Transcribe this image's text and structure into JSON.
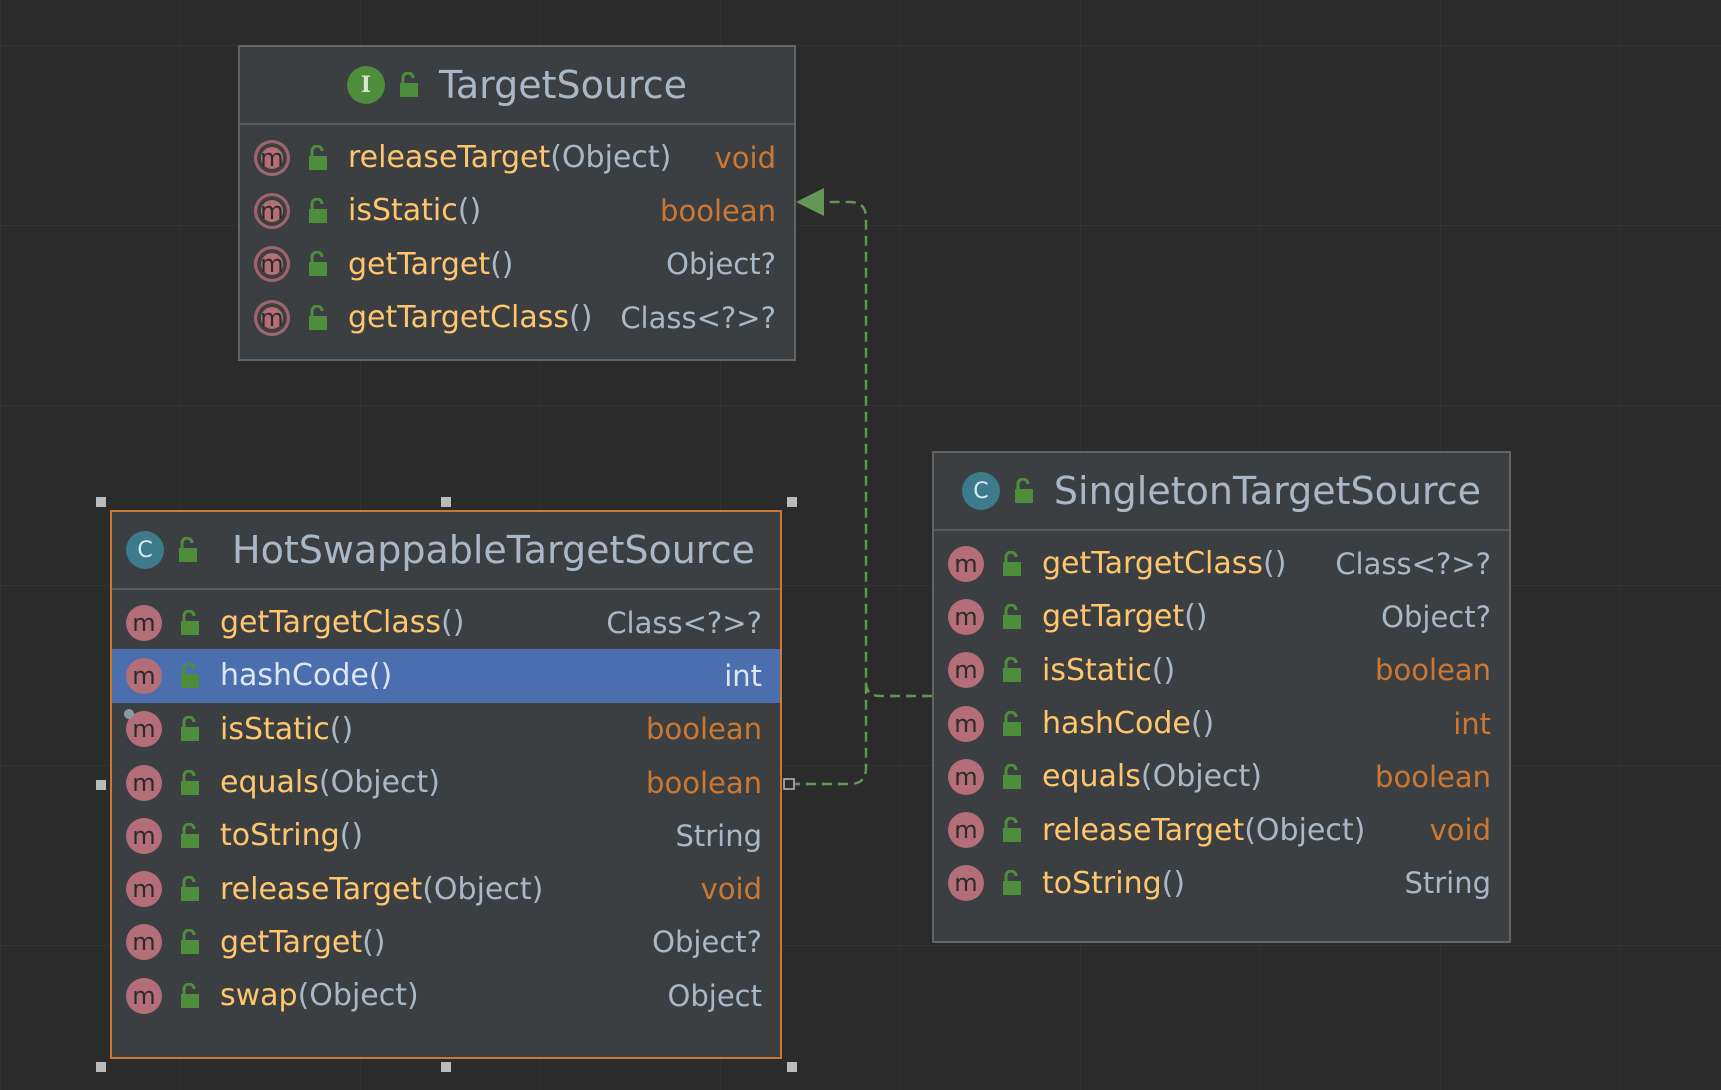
{
  "diagram": {
    "nodes": [
      {
        "id": "target-source",
        "title": "TargetSource",
        "kind": "interface",
        "kind_letter": "I",
        "methods": [
          {
            "name": "releaseTarget",
            "params": "(Object)",
            "type": "void",
            "type_is_keyword": true
          },
          {
            "name": "isStatic",
            "params": "()",
            "type": "boolean",
            "type_is_keyword": true
          },
          {
            "name": "getTarget",
            "params": "()",
            "type": "Object?",
            "type_is_keyword": false
          },
          {
            "name": "getTargetClass",
            "params": "()",
            "type": "Class<?>?",
            "type_is_keyword": false
          }
        ]
      },
      {
        "id": "singleton-target-source",
        "title": "SingletonTargetSource",
        "kind": "class",
        "kind_letter": "C",
        "methods": [
          {
            "name": "getTargetClass",
            "params": "()",
            "type": "Class<?>?",
            "type_is_keyword": false
          },
          {
            "name": "getTarget",
            "params": "()",
            "type": "Object?",
            "type_is_keyword": false
          },
          {
            "name": "isStatic",
            "params": "()",
            "type": "boolean",
            "type_is_keyword": true
          },
          {
            "name": "hashCode",
            "params": "()",
            "type": "int",
            "type_is_keyword": true
          },
          {
            "name": "equals",
            "params": "(Object)",
            "type": "boolean",
            "type_is_keyword": true
          },
          {
            "name": "releaseTarget",
            "params": "(Object)",
            "type": "void",
            "type_is_keyword": true
          },
          {
            "name": "toString",
            "params": "()",
            "type": "String",
            "type_is_keyword": false
          }
        ]
      },
      {
        "id": "hot-swappable-target-source",
        "title": "HotSwappableTargetSource",
        "kind": "class",
        "kind_letter": "C",
        "selected": true,
        "methods": [
          {
            "name": "getTargetClass",
            "params": "()",
            "type": "Class<?>?",
            "type_is_keyword": false
          },
          {
            "name": "hashCode",
            "params": "()",
            "type": "int",
            "type_is_keyword": true,
            "selected": true
          },
          {
            "name": "isStatic",
            "params": "()",
            "type": "boolean",
            "type_is_keyword": true
          },
          {
            "name": "equals",
            "params": "(Object)",
            "type": "boolean",
            "type_is_keyword": true
          },
          {
            "name": "toString",
            "params": "()",
            "type": "String",
            "type_is_keyword": false
          },
          {
            "name": "releaseTarget",
            "params": "(Object)",
            "type": "void",
            "type_is_keyword": true
          },
          {
            "name": "getTarget",
            "params": "()",
            "type": "Object?",
            "type_is_keyword": false
          },
          {
            "name": "swap",
            "params": "(Object)",
            "type": "Object",
            "type_is_keyword": false
          }
        ]
      }
    ],
    "method_icon_letter": "m",
    "relations": [
      {
        "from": "hot-swappable-target-source",
        "to": "target-source",
        "kind": "implements"
      },
      {
        "from": "singleton-target-source",
        "to": "target-source",
        "kind": "implements"
      }
    ],
    "colors": {
      "background": "#2b2b2b",
      "node_bg": "#3c3f41",
      "method_name": "#ffc66d",
      "keyword": "#cc7832",
      "text": "#a9b7c6",
      "selection": "#4b6eaf",
      "selected_border": "#cc7832",
      "edge": "#629755"
    }
  }
}
